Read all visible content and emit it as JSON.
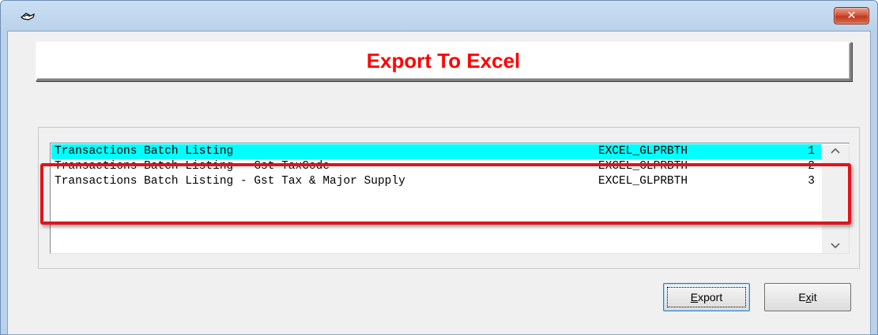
{
  "window": {
    "title": "",
    "close_label": "✕"
  },
  "header": {
    "title": "Export To Excel",
    "title_color": "#ff0000"
  },
  "list": {
    "selected_color": "#00ffff",
    "rows": [
      {
        "desc": "Transactions Batch Listing",
        "code": "EXCEL_GLPRBTH",
        "num": "1",
        "selected": true
      },
      {
        "desc": "Transactions Batch Listing - Gst TaxCode",
        "code": "EXCEL_GLPRBTH",
        "num": "2",
        "selected": false
      },
      {
        "desc": "Transactions Batch Listing - Gst Tax & Major Supply",
        "code": "EXCEL_GLPRBTH",
        "num": "3",
        "selected": false
      }
    ],
    "scroll_up_icon": "chevron-up-icon",
    "scroll_down_icon": "chevron-down-icon"
  },
  "annotation": {
    "highlight_color": "#e0141b"
  },
  "buttons": {
    "export": {
      "prefix": "",
      "mnemonic": "E",
      "rest": "xport"
    },
    "exit": {
      "prefix": "E",
      "mnemonic": "x",
      "rest": "it"
    }
  }
}
